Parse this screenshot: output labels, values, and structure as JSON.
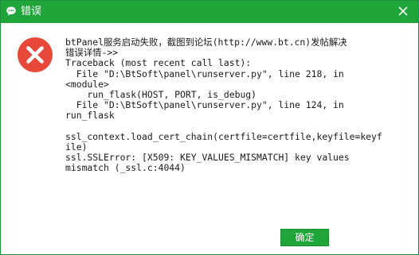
{
  "window": {
    "title": "错误",
    "accent_color": "#20a53a",
    "icon": "chat-bubble-icon",
    "close_icon": "close-icon"
  },
  "message": {
    "icon": "error-x-icon",
    "icon_color": "#e8483a",
    "lines": [
      "btPanel服务启动失败，截图到论坛(http://www.bt.cn)发帖解决",
      "错误详情->>",
      "Traceback (most recent call last):",
      "  File \"D:\\BtSoft\\panel\\runserver.py\", line 218, in",
      "<module>",
      "    run_flask(HOST, PORT, is_debug)",
      "  File \"D:\\BtSoft\\panel\\runserver.py\", line 124, in",
      "run_flask",
      "",
      "ssl_context.load_cert_chain(certfile=certfile,keyfile=keyf",
      "ile)",
      "ssl.SSLError: [X509: KEY_VALUES_MISMATCH] key values",
      "mismatch (_ssl.c:4044)"
    ]
  },
  "buttons": {
    "ok_label": "确定"
  }
}
